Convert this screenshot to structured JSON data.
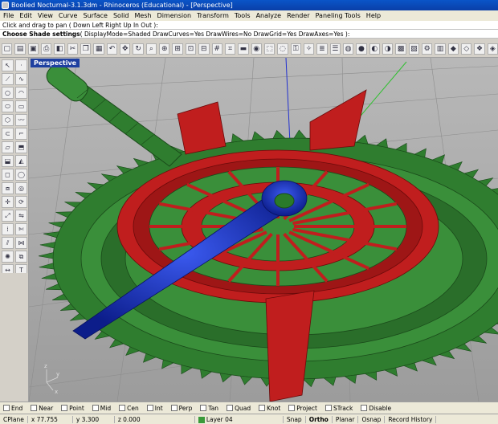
{
  "window": {
    "title": "Boolied Nocturnal-3.1.3dm - Rhinoceros (Educational) - [Perspective]"
  },
  "menu": {
    "items": [
      "File",
      "Edit",
      "View",
      "Curve",
      "Surface",
      "Solid",
      "Mesh",
      "Dimension",
      "Transform",
      "Tools",
      "Analyze",
      "Render",
      "Paneling Tools",
      "Help"
    ]
  },
  "command": {
    "history": "Click and drag to pan ( Down  Left  Right  Up  In  Out ):",
    "prompt": "Choose Shade settings",
    "options": "( DisplayMode=Shaded  DrawCurves=Yes  DrawWires=No  DrawGrid=Yes  DrawAxes=Yes ):"
  },
  "viewport": {
    "label": "Perspective",
    "axis_x": "x",
    "axis_y": "y",
    "axis_z": "z"
  },
  "osnap": {
    "items": [
      "End",
      "Near",
      "Point",
      "Mid",
      "Cen",
      "Int",
      "Perp",
      "Tan",
      "Quad",
      "Knot",
      "Project",
      "STrack",
      "Disable"
    ]
  },
  "status": {
    "cplane": "CPlane",
    "x": "x 77.755",
    "y": "y 3.300",
    "z": "z 0.000",
    "layer": "Layer 04",
    "snap": "Snap",
    "ortho": "Ortho",
    "planar": "Planar",
    "osnap": "Osnap",
    "record": "Record History"
  },
  "colors": {
    "green_gear": "#2f7d2f",
    "red_dial": "#c01e1e",
    "blue_hand": "#1a2fb4",
    "viewport_bg": "#a8a8a8"
  }
}
